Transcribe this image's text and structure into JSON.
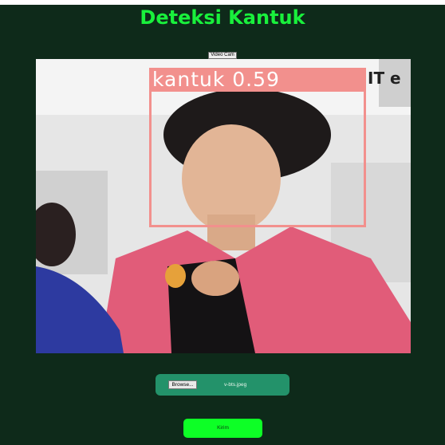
{
  "page": {
    "title": "Deteksi Kantuk",
    "video_cam_button": "Video Cam"
  },
  "preview": {
    "detection_label": "kantuk 0.59",
    "background_text": "IT e"
  },
  "upload": {
    "browse_button": "Browse...",
    "file_name": "v-bts.jpeg"
  },
  "submit": {
    "label": "Kirim"
  },
  "colors": {
    "background": "#0e2a1a",
    "title": "#19f03c",
    "upload_panel": "#23926a",
    "submit_button": "#0dff26",
    "detection_box": "#f2908d"
  }
}
